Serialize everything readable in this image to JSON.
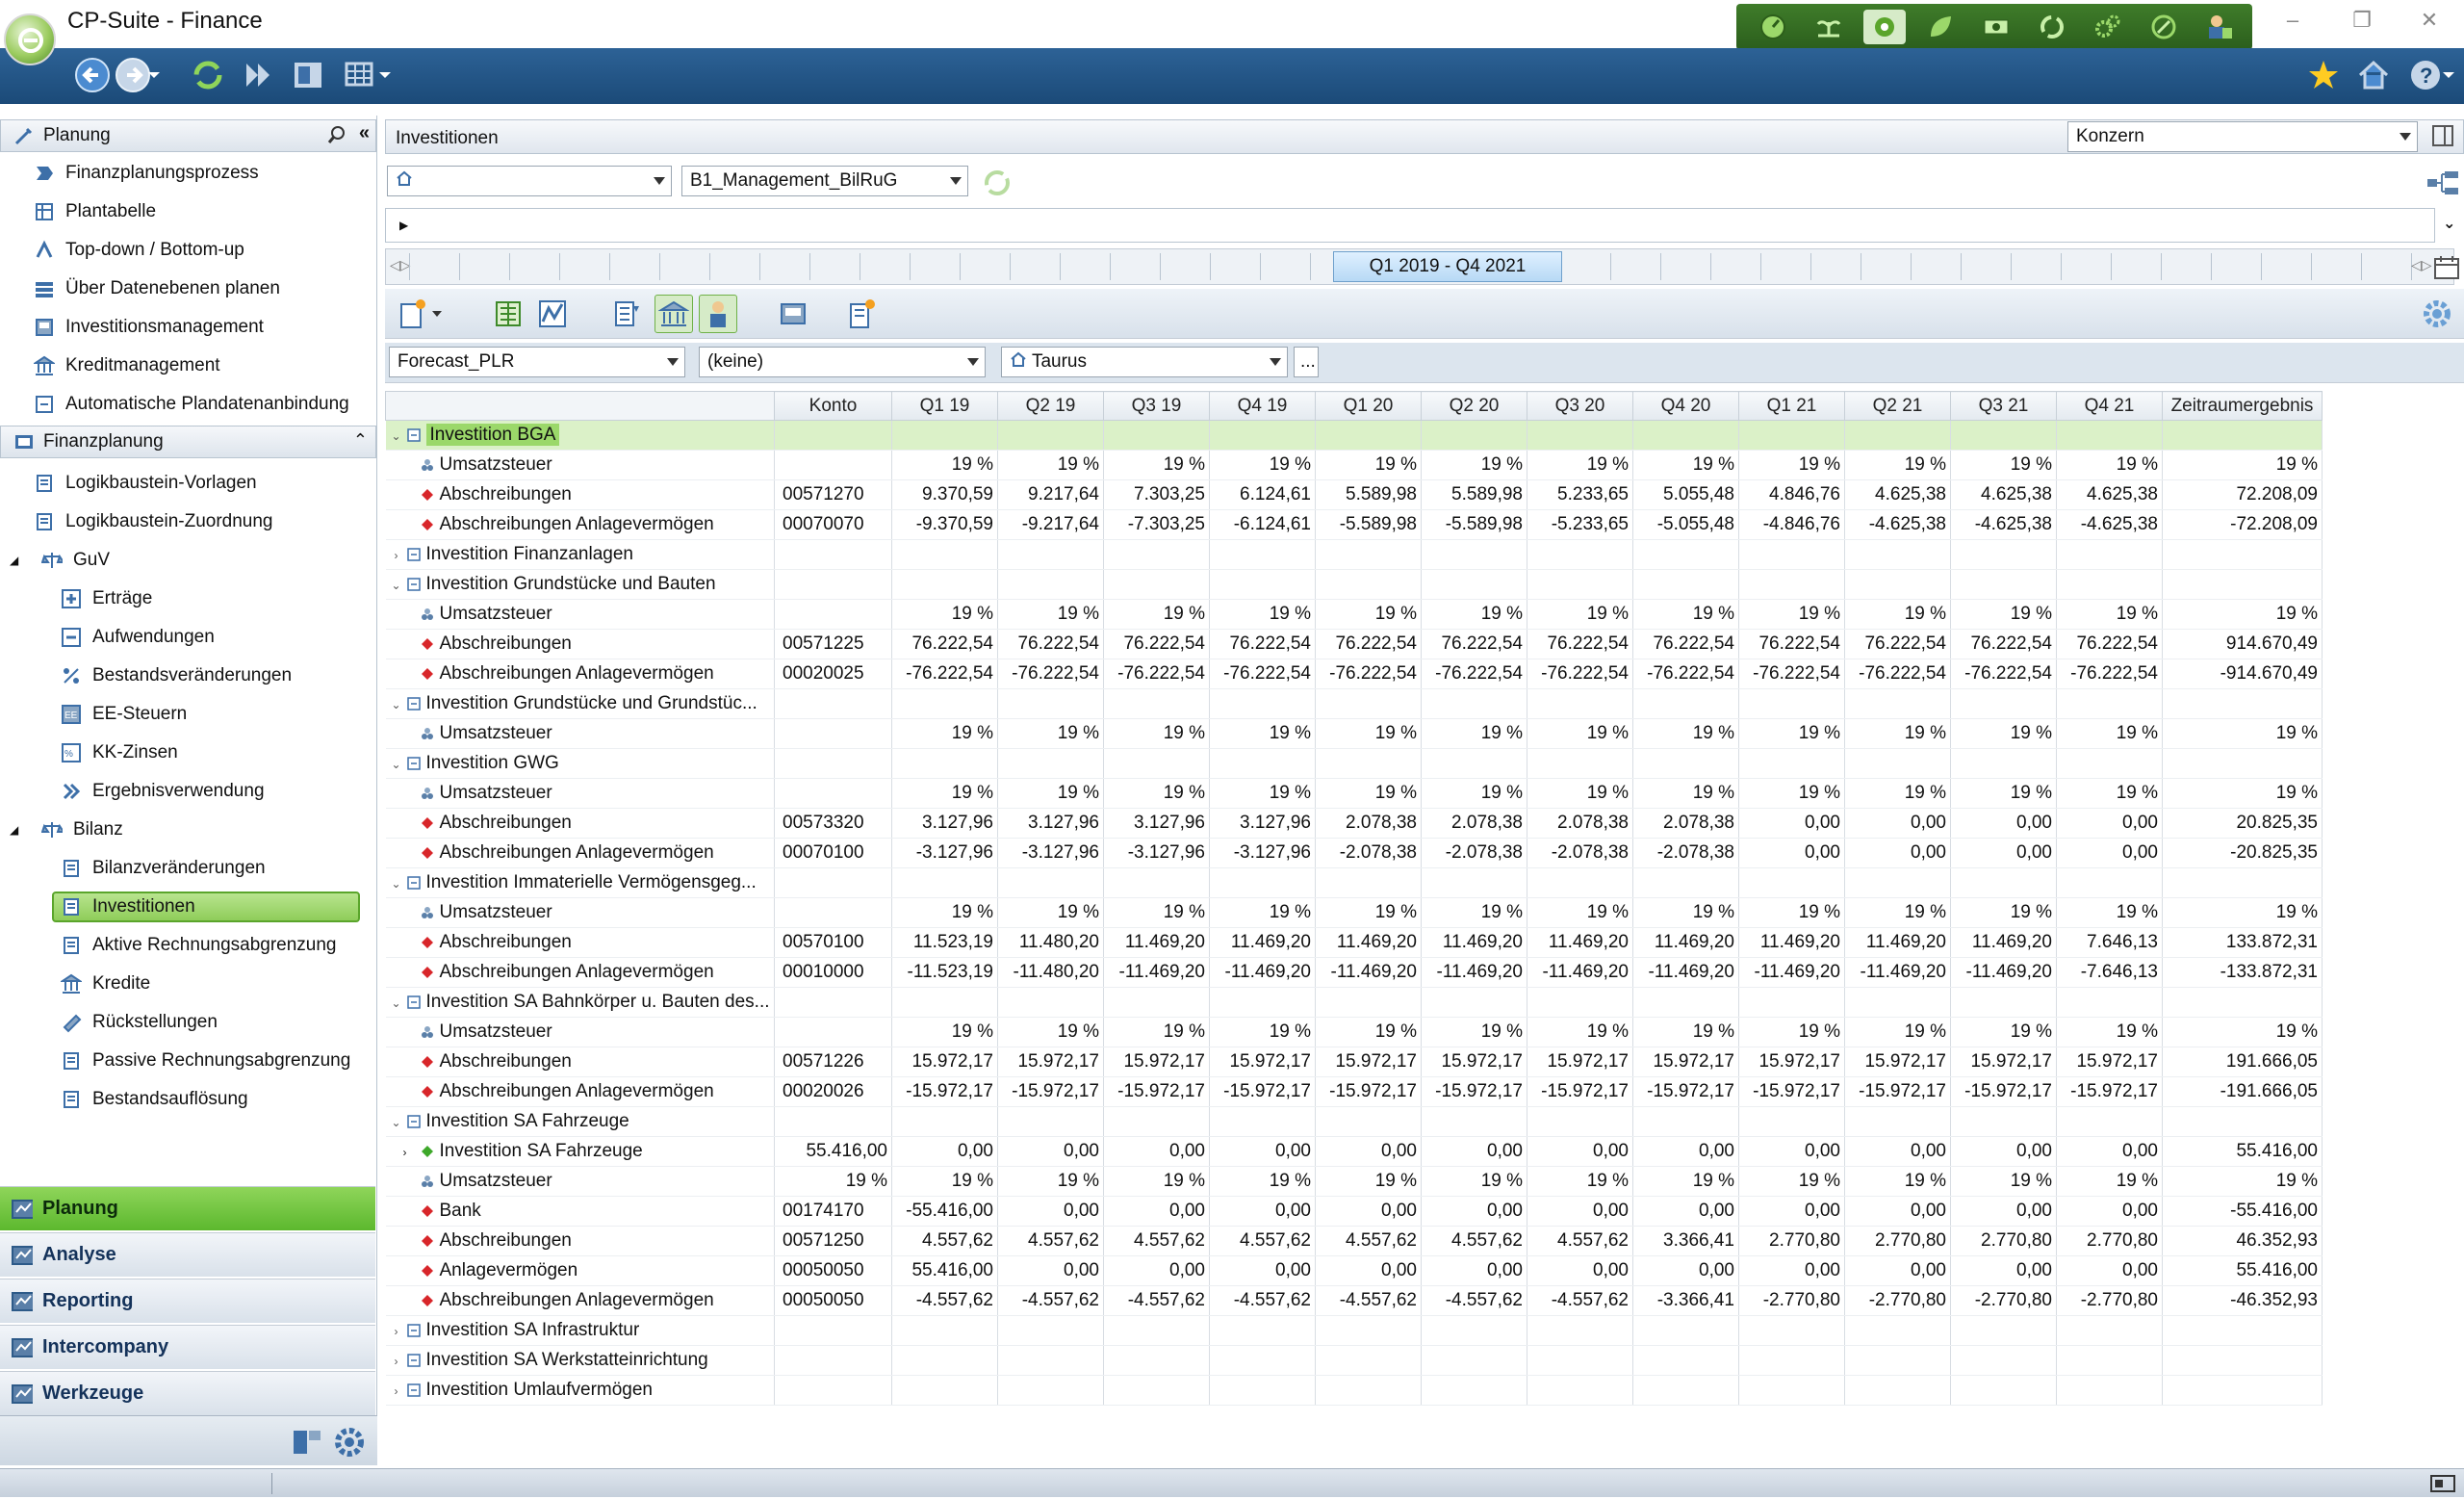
{
  "app": {
    "title": "CP-Suite - Finance"
  },
  "sidebar": {
    "panel_title": "Planung",
    "planung_items": [
      {
        "label": "Finanzplanungsprozess"
      },
      {
        "label": "Plantabelle"
      },
      {
        "label": "Top-down / Bottom-up"
      },
      {
        "label": "Über Datenebenen planen"
      },
      {
        "label": "Investitionsmanagement"
      },
      {
        "label": "Kreditmanagement"
      },
      {
        "label": "Automatische Plandatenanbindung"
      }
    ],
    "section_finanzplanung": "Finanzplanung",
    "fp_items": [
      {
        "label": "Logikbaustein-Vorlagen"
      },
      {
        "label": "Logikbaustein-Zuordnung"
      }
    ],
    "guv": {
      "label": "GuV",
      "children": [
        "Erträge",
        "Aufwendungen",
        "Bestandsveränderungen",
        "EE-Steuern",
        "KK-Zinsen",
        "Ergebnisverwendung"
      ]
    },
    "bilanz": {
      "label": "Bilanz",
      "children": [
        "Bilanzveränderungen",
        "Investitionen",
        "Aktive Rechnungsabgrenzung",
        "Kredite",
        "Rückstellungen",
        "Passive Rechnungsabgrenzung",
        "Bestandsauflösung"
      ],
      "selected": "Investitionen"
    },
    "nav_sections": [
      "Planung",
      "Analyse",
      "Reporting",
      "Intercompany",
      "Werkzeuge"
    ],
    "active_section": "Planung"
  },
  "main": {
    "header": "Investitionen",
    "scope_select": "Konzern",
    "home_select": "",
    "model_select": "B1_Management_BilRuG",
    "timeline_label": "Q1 2019 - Q4 2021",
    "filters": {
      "scenario": "Forecast_PLR",
      "second": "(keine)",
      "entity": "Taurus",
      "more": "..."
    }
  },
  "table": {
    "columns": [
      "",
      "Konto",
      "Q1 19",
      "Q2 19",
      "Q3 19",
      "Q4 19",
      "Q1 20",
      "Q2 20",
      "Q3 20",
      "Q4 20",
      "Q1 21",
      "Q2 21",
      "Q3 21",
      "Q4 21",
      "Zeitraumergebnis"
    ],
    "rows": [
      {
        "t": "g",
        "exp": "open",
        "name": "Investition BGA",
        "hl": true,
        "konto": "",
        "v": [
          "",
          "",
          "",
          "",
          "",
          "",
          "",
          "",
          "",
          "",
          "",
          "",
          ""
        ]
      },
      {
        "t": "c",
        "ic": "tax",
        "name": "Umsatzsteuer",
        "konto": "",
        "v": [
          "19 %",
          "19 %",
          "19 %",
          "19 %",
          "19 %",
          "19 %",
          "19 %",
          "19 %",
          "19 %",
          "19 %",
          "19 %",
          "19 %",
          "19 %"
        ]
      },
      {
        "t": "c",
        "ic": "red",
        "name": "Abschreibungen",
        "konto": "00571270",
        "v": [
          "9.370,59",
          "9.217,64",
          "7.303,25",
          "6.124,61",
          "5.589,98",
          "5.589,98",
          "5.233,65",
          "5.055,48",
          "4.846,76",
          "4.625,38",
          "4.625,38",
          "4.625,38",
          "72.208,09"
        ]
      },
      {
        "t": "c",
        "ic": "red",
        "name": "Abschreibungen Anlagevermögen",
        "konto": "00070070",
        "v": [
          "-9.370,59",
          "-9.217,64",
          "-7.303,25",
          "-6.124,61",
          "-5.589,98",
          "-5.589,98",
          "-5.233,65",
          "-5.055,48",
          "-4.846,76",
          "-4.625,38",
          "-4.625,38",
          "-4.625,38",
          "-72.208,09"
        ]
      },
      {
        "t": "g",
        "exp": "closed",
        "name": "Investition Finanzanlagen",
        "konto": "",
        "v": [
          "",
          "",
          "",
          "",
          "",
          "",
          "",
          "",
          "",
          "",
          "",
          "",
          ""
        ]
      },
      {
        "t": "g",
        "exp": "open",
        "name": "Investition Grundstücke und Bauten",
        "konto": "",
        "v": [
          "",
          "",
          "",
          "",
          "",
          "",
          "",
          "",
          "",
          "",
          "",
          "",
          ""
        ]
      },
      {
        "t": "c",
        "ic": "tax",
        "name": "Umsatzsteuer",
        "konto": "",
        "v": [
          "19 %",
          "19 %",
          "19 %",
          "19 %",
          "19 %",
          "19 %",
          "19 %",
          "19 %",
          "19 %",
          "19 %",
          "19 %",
          "19 %",
          "19 %"
        ]
      },
      {
        "t": "c",
        "ic": "red",
        "name": "Abschreibungen",
        "konto": "00571225",
        "v": [
          "76.222,54",
          "76.222,54",
          "76.222,54",
          "76.222,54",
          "76.222,54",
          "76.222,54",
          "76.222,54",
          "76.222,54",
          "76.222,54",
          "76.222,54",
          "76.222,54",
          "76.222,54",
          "914.670,49"
        ]
      },
      {
        "t": "c",
        "ic": "red",
        "name": "Abschreibungen Anlagevermögen",
        "konto": "00020025",
        "v": [
          "-76.222,54",
          "-76.222,54",
          "-76.222,54",
          "-76.222,54",
          "-76.222,54",
          "-76.222,54",
          "-76.222,54",
          "-76.222,54",
          "-76.222,54",
          "-76.222,54",
          "-76.222,54",
          "-76.222,54",
          "-914.670,49"
        ]
      },
      {
        "t": "g",
        "exp": "open",
        "name": "Investition Grundstücke und Grundstüc...",
        "konto": "",
        "v": [
          "",
          "",
          "",
          "",
          "",
          "",
          "",
          "",
          "",
          "",
          "",
          "",
          ""
        ]
      },
      {
        "t": "c",
        "ic": "tax",
        "name": "Umsatzsteuer",
        "konto": "",
        "v": [
          "19 %",
          "19 %",
          "19 %",
          "19 %",
          "19 %",
          "19 %",
          "19 %",
          "19 %",
          "19 %",
          "19 %",
          "19 %",
          "19 %",
          "19 %"
        ]
      },
      {
        "t": "g",
        "exp": "open",
        "name": "Investition GWG",
        "konto": "",
        "v": [
          "",
          "",
          "",
          "",
          "",
          "",
          "",
          "",
          "",
          "",
          "",
          "",
          ""
        ]
      },
      {
        "t": "c",
        "ic": "tax",
        "name": "Umsatzsteuer",
        "konto": "",
        "v": [
          "19 %",
          "19 %",
          "19 %",
          "19 %",
          "19 %",
          "19 %",
          "19 %",
          "19 %",
          "19 %",
          "19 %",
          "19 %",
          "19 %",
          "19 %"
        ]
      },
      {
        "t": "c",
        "ic": "red",
        "name": "Abschreibungen",
        "konto": "00573320",
        "v": [
          "3.127,96",
          "3.127,96",
          "3.127,96",
          "3.127,96",
          "2.078,38",
          "2.078,38",
          "2.078,38",
          "2.078,38",
          "0,00",
          "0,00",
          "0,00",
          "0,00",
          "20.825,35"
        ]
      },
      {
        "t": "c",
        "ic": "red",
        "name": "Abschreibungen Anlagevermögen",
        "konto": "00070100",
        "v": [
          "-3.127,96",
          "-3.127,96",
          "-3.127,96",
          "-3.127,96",
          "-2.078,38",
          "-2.078,38",
          "-2.078,38",
          "-2.078,38",
          "0,00",
          "0,00",
          "0,00",
          "0,00",
          "-20.825,35"
        ]
      },
      {
        "t": "g",
        "exp": "open",
        "name": "Investition Immaterielle Vermögensgeg...",
        "konto": "",
        "v": [
          "",
          "",
          "",
          "",
          "",
          "",
          "",
          "",
          "",
          "",
          "",
          "",
          ""
        ]
      },
      {
        "t": "c",
        "ic": "tax",
        "name": "Umsatzsteuer",
        "konto": "",
        "v": [
          "19 %",
          "19 %",
          "19 %",
          "19 %",
          "19 %",
          "19 %",
          "19 %",
          "19 %",
          "19 %",
          "19 %",
          "19 %",
          "19 %",
          "19 %"
        ]
      },
      {
        "t": "c",
        "ic": "red",
        "name": "Abschreibungen",
        "konto": "00570100",
        "v": [
          "11.523,19",
          "11.480,20",
          "11.469,20",
          "11.469,20",
          "11.469,20",
          "11.469,20",
          "11.469,20",
          "11.469,20",
          "11.469,20",
          "11.469,20",
          "11.469,20",
          "7.646,13",
          "133.872,31"
        ]
      },
      {
        "t": "c",
        "ic": "red",
        "name": "Abschreibungen Anlagevermögen",
        "konto": "00010000",
        "v": [
          "-11.523,19",
          "-11.480,20",
          "-11.469,20",
          "-11.469,20",
          "-11.469,20",
          "-11.469,20",
          "-11.469,20",
          "-11.469,20",
          "-11.469,20",
          "-11.469,20",
          "-11.469,20",
          "-7.646,13",
          "-133.872,31"
        ]
      },
      {
        "t": "g",
        "exp": "open",
        "name": "Investition SA Bahnkörper u. Bauten des...",
        "konto": "",
        "v": [
          "",
          "",
          "",
          "",
          "",
          "",
          "",
          "",
          "",
          "",
          "",
          "",
          ""
        ]
      },
      {
        "t": "c",
        "ic": "tax",
        "name": "Umsatzsteuer",
        "konto": "",
        "v": [
          "19 %",
          "19 %",
          "19 %",
          "19 %",
          "19 %",
          "19 %",
          "19 %",
          "19 %",
          "19 %",
          "19 %",
          "19 %",
          "19 %",
          "19 %"
        ]
      },
      {
        "t": "c",
        "ic": "red",
        "name": "Abschreibungen",
        "konto": "00571226",
        "v": [
          "15.972,17",
          "15.972,17",
          "15.972,17",
          "15.972,17",
          "15.972,17",
          "15.972,17",
          "15.972,17",
          "15.972,17",
          "15.972,17",
          "15.972,17",
          "15.972,17",
          "15.972,17",
          "191.666,05"
        ]
      },
      {
        "t": "c",
        "ic": "red",
        "name": "Abschreibungen Anlagevermögen",
        "konto": "00020026",
        "v": [
          "-15.972,17",
          "-15.972,17",
          "-15.972,17",
          "-15.972,17",
          "-15.972,17",
          "-15.972,17",
          "-15.972,17",
          "-15.972,17",
          "-15.972,17",
          "-15.972,17",
          "-15.972,17",
          "-15.972,17",
          "-191.666,05"
        ]
      },
      {
        "t": "g",
        "exp": "open",
        "name": "Investition SA Fahrzeuge",
        "konto": "",
        "v": [
          "",
          "",
          "",
          "",
          "",
          "",
          "",
          "",
          "",
          "",
          "",
          "",
          ""
        ]
      },
      {
        "t": "c",
        "ic": "green",
        "sub": true,
        "name": "Investition SA Fahrzeuge",
        "konto": "55.416,00",
        "v": [
          "0,00",
          "0,00",
          "0,00",
          "0,00",
          "0,00",
          "0,00",
          "0,00",
          "0,00",
          "0,00",
          "0,00",
          "0,00",
          "0,00",
          "55.416,00"
        ]
      },
      {
        "t": "c",
        "ic": "tax",
        "name": "Umsatzsteuer",
        "konto": "19 %",
        "v": [
          "19 %",
          "19 %",
          "19 %",
          "19 %",
          "19 %",
          "19 %",
          "19 %",
          "19 %",
          "19 %",
          "19 %",
          "19 %",
          "19 %",
          "19 %"
        ]
      },
      {
        "t": "c",
        "ic": "red",
        "name": "Bank",
        "konto": "00174170",
        "v": [
          "-55.416,00",
          "0,00",
          "0,00",
          "0,00",
          "0,00",
          "0,00",
          "0,00",
          "0,00",
          "0,00",
          "0,00",
          "0,00",
          "0,00",
          "-55.416,00"
        ]
      },
      {
        "t": "c",
        "ic": "red",
        "name": "Abschreibungen",
        "konto": "00571250",
        "v": [
          "4.557,62",
          "4.557,62",
          "4.557,62",
          "4.557,62",
          "4.557,62",
          "4.557,62",
          "4.557,62",
          "3.366,41",
          "2.770,80",
          "2.770,80",
          "2.770,80",
          "2.770,80",
          "46.352,93"
        ]
      },
      {
        "t": "c",
        "ic": "red",
        "name": "Anlagevermögen",
        "konto": "00050050",
        "v": [
          "55.416,00",
          "0,00",
          "0,00",
          "0,00",
          "0,00",
          "0,00",
          "0,00",
          "0,00",
          "0,00",
          "0,00",
          "0,00",
          "0,00",
          "55.416,00"
        ]
      },
      {
        "t": "c",
        "ic": "red",
        "name": "Abschreibungen Anlagevermögen",
        "konto": "00050050",
        "v": [
          "-4.557,62",
          "-4.557,62",
          "-4.557,62",
          "-4.557,62",
          "-4.557,62",
          "-4.557,62",
          "-4.557,62",
          "-3.366,41",
          "-2.770,80",
          "-2.770,80",
          "-2.770,80",
          "-2.770,80",
          "-46.352,93"
        ]
      },
      {
        "t": "g",
        "exp": "closed",
        "name": "Investition SA Infrastruktur",
        "konto": "",
        "v": [
          "",
          "",
          "",
          "",
          "",
          "",
          "",
          "",
          "",
          "",
          "",
          "",
          ""
        ]
      },
      {
        "t": "g",
        "exp": "closed",
        "name": "Investition SA Werkstatteinrichtung",
        "konto": "",
        "v": [
          "",
          "",
          "",
          "",
          "",
          "",
          "",
          "",
          "",
          "",
          "",
          "",
          ""
        ]
      },
      {
        "t": "g",
        "exp": "closed",
        "name": "Investition Umlaufvermögen",
        "konto": "",
        "v": [
          "",
          "",
          "",
          "",
          "",
          "",
          "",
          "",
          "",
          "",
          "",
          "",
          ""
        ]
      }
    ]
  }
}
